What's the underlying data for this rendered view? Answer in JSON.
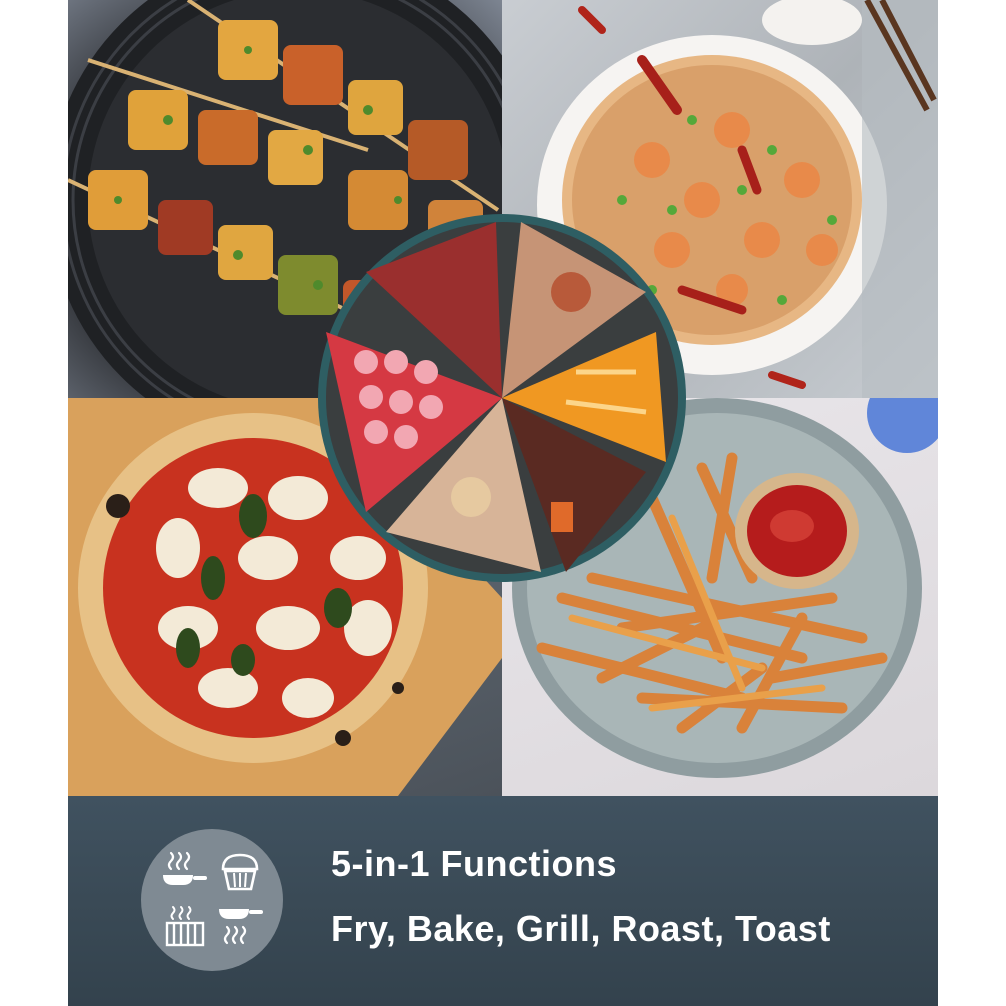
{
  "banner": {
    "line1": "5-in-1 Functions",
    "line2": "Fry, Bake, Grill, Roast, Toast"
  },
  "icons": [
    "pan-steam-icon",
    "muffin-icon",
    "grill-icon",
    "pan-heat-icon"
  ],
  "photos": [
    "paneer-skewers-photo",
    "shrimp-fried-rice-photo",
    "margherita-pizza-photo",
    "french-fries-photo",
    "cake-slices-photo"
  ],
  "colors": {
    "banner": "#3a4a56",
    "icon_circle": "#7f8a93",
    "text": "#ffffff"
  }
}
